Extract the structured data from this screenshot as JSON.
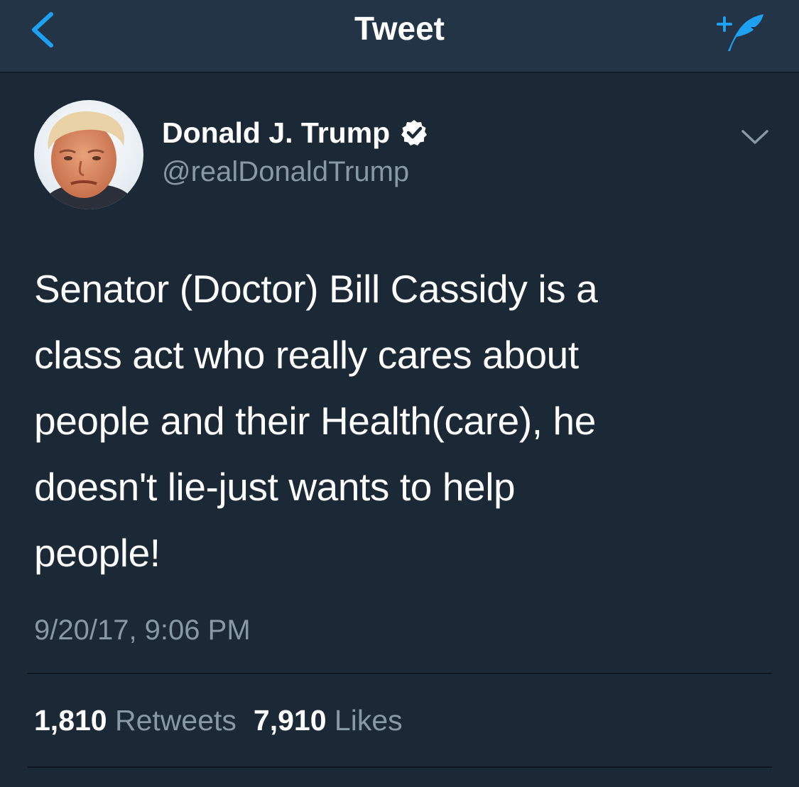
{
  "nav": {
    "title": "Tweet",
    "back_icon": "chevron-left-icon",
    "compose_icon": "compose-tweet-icon"
  },
  "tweet": {
    "author": {
      "name": "Donald J. Trump",
      "handle": "@realDonaldTrump",
      "verified": true
    },
    "text": "Senator (Doctor) Bill Cassidy is a\nclass act who really cares about\npeople and their Health(care), he\ndoesn't lie-just wants to help\npeople!",
    "timestamp": "9/20/17, 9:06 PM",
    "stats": {
      "retweets_count": "1,810",
      "retweets_label": "Retweets",
      "likes_count": "7,910",
      "likes_label": "Likes"
    }
  },
  "colors": {
    "background": "#1b2836",
    "nav_background": "#243447",
    "accent": "#1da1f2",
    "secondary_text": "#8899a6",
    "primary_text": "#ffffff"
  }
}
